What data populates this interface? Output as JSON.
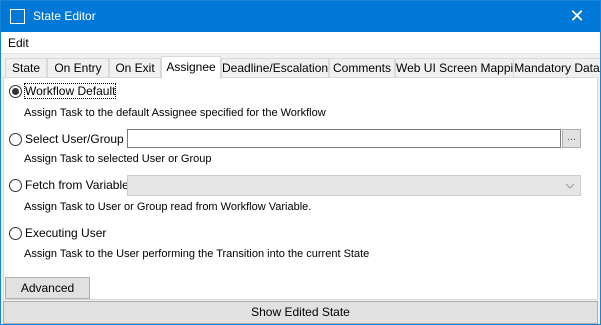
{
  "window": {
    "title": "State Editor",
    "close_glyph": "✕"
  },
  "menu": {
    "items": [
      "Edit"
    ]
  },
  "tabs": [
    {
      "label": "State"
    },
    {
      "label": "On Entry"
    },
    {
      "label": "On Exit"
    },
    {
      "label": "Assignee",
      "active": true
    },
    {
      "label": "Deadline/Escalation"
    },
    {
      "label": "Comments"
    },
    {
      "label": "Web UI Screen Mapping"
    },
    {
      "label": "Mandatory Data"
    }
  ],
  "options": [
    {
      "label": "Workflow Default",
      "checked": true,
      "description": "Assign Task to the default Assignee specified for the Workflow"
    },
    {
      "label": "Select User/Group",
      "checked": false,
      "description": "Assign Task to selected User or Group",
      "input_value": "",
      "browse_label": "..."
    },
    {
      "label": "Fetch from Variable",
      "checked": false,
      "description": "Assign Task to User or Group read from Workflow Variable.",
      "selected_value": ""
    },
    {
      "label": "Executing User",
      "checked": false,
      "description": "Assign Task to the User performing the Transition into the current State"
    }
  ],
  "buttons": {
    "advanced": "Advanced",
    "show_edited_state": "Show Edited State"
  },
  "colors": {
    "titlebar": "#0078d7",
    "panel": "#ffffff",
    "window": "#f0f0f0"
  }
}
